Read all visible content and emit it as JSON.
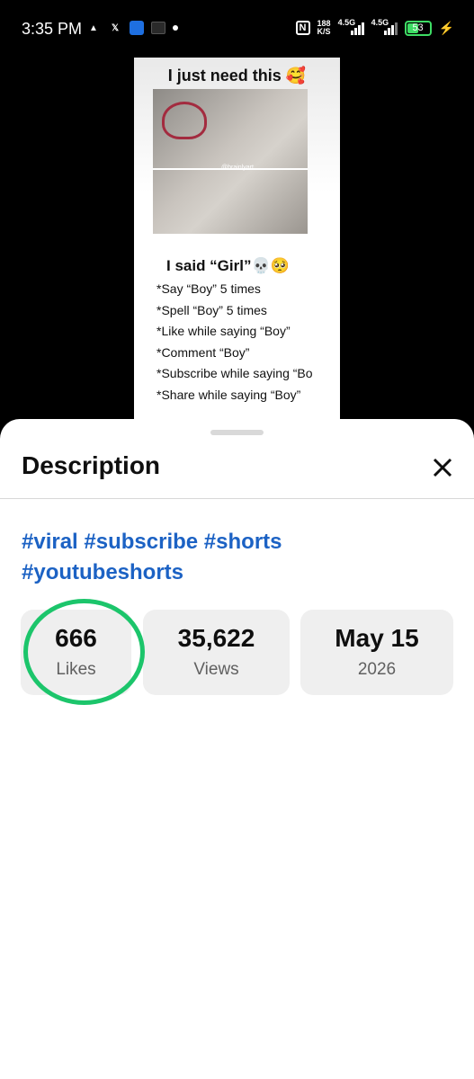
{
  "status_bar": {
    "time": "3:35 PM",
    "speed_value": "188",
    "speed_unit": "K/S",
    "signal1_label": "4.5G",
    "signal2_label": "4.5G",
    "battery_level": "53",
    "icons": [
      "app-icon-a",
      "x-icon",
      "app-icon-blue",
      "app-icon-dark",
      "dot-icon",
      "nfc-icon",
      "signal-icon",
      "battery-icon",
      "charging-bolt-icon"
    ]
  },
  "video": {
    "headline": "I just need this 🥰",
    "watermark": "@brainlyart",
    "subhead": "I said “Girl”💀🥺",
    "lines": [
      "*Say “Boy” 5 times",
      "*Spell “Boy” 5 times",
      "*Like while saying “Boy”",
      "*Comment “Boy”",
      "*Subscribe while saying “Bo",
      "*Share while saying “Boy”"
    ]
  },
  "sheet": {
    "title": "Description",
    "hashtags": [
      "#viral",
      "#subscribe",
      "#shorts",
      "#youtubeshorts"
    ],
    "stats": {
      "likes": {
        "value": "666",
        "label": "Likes"
      },
      "views": {
        "value": "35,622",
        "label": "Views"
      },
      "date": {
        "value": "May 15",
        "label": "2026"
      }
    },
    "annotation_color": "#1cc56b",
    "hashtag_color": "#1c62c4"
  }
}
